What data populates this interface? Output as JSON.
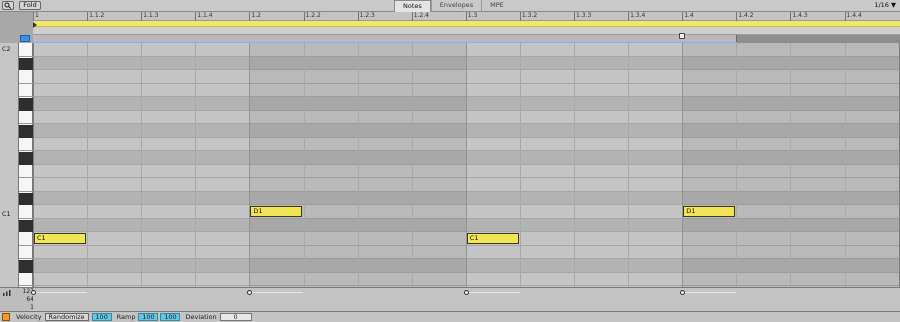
{
  "toolbar": {
    "search_icon": "search-icon",
    "fold_label": "Fold",
    "tabs": [
      "Notes",
      "Envelopes",
      "MPE"
    ],
    "active_tab": "Notes",
    "grid_value": "1/16 ▼"
  },
  "ruler": {
    "labels": [
      "1",
      "1.1.2",
      "1.1.3",
      "1.1.4",
      "1.2",
      "1.2.2",
      "1.2.3",
      "1.2.4",
      "1.3",
      "1.3.2",
      "1.3.3",
      "1.3.4",
      "1.4",
      "1.4.2",
      "1.4.3",
      "1.4.4"
    ]
  },
  "keyboard": {
    "octave_labels": [
      "C2",
      "C1"
    ]
  },
  "notes": [
    {
      "name": "C1",
      "pitch": "C1",
      "start": 0,
      "length": 1
    },
    {
      "name": "D1",
      "pitch": "D1",
      "start": 4,
      "length": 1
    },
    {
      "name": "C1",
      "pitch": "C1",
      "start": 8,
      "length": 1
    },
    {
      "name": "D1",
      "pitch": "D1",
      "start": 12,
      "length": 1
    }
  ],
  "velocity_lane": {
    "labels": [
      "127",
      "64",
      "1"
    ]
  },
  "bottom": {
    "velocity_label": "Velocity",
    "randomize_label": "Randomize",
    "randomize_value": "100",
    "ramp_label": "Ramp",
    "ramp_value_1": "100",
    "ramp_value_2": "100",
    "deviation_label": "Deviation",
    "deviation_value": "0"
  },
  "colors": {
    "note_fill": "#f2e555",
    "loop_bar": "#f0e86a",
    "accent_blue": "#3d8ef0",
    "value_field": "#62c7e6"
  }
}
